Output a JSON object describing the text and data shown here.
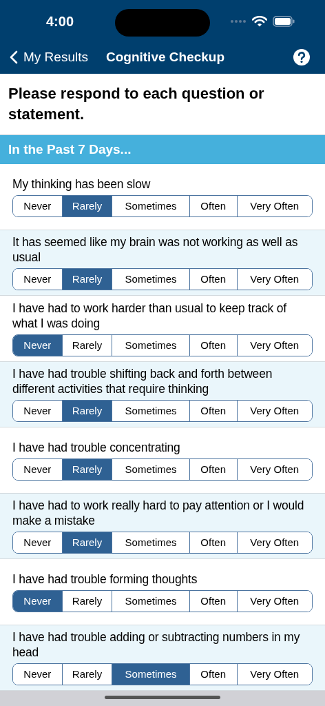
{
  "status_bar": {
    "time": "4:00"
  },
  "nav": {
    "back_label": "My Results",
    "title": "Cognitive Checkup"
  },
  "instructions": "Please respond to each question or statement.",
  "section_header": "In the Past 7 Days...",
  "questions": [
    {
      "text": "My thinking has been slow",
      "options": [
        {
          "label": "Never",
          "selected": false
        },
        {
          "label": "Rarely",
          "selected": true
        },
        {
          "label": "Sometimes",
          "selected": false
        },
        {
          "label": "Often",
          "selected": false
        },
        {
          "label": "Very Often",
          "selected": false
        }
      ]
    },
    {
      "text": "It has seemed like my brain was not working as well as usual",
      "options": [
        {
          "label": "Never",
          "selected": false
        },
        {
          "label": "Rarely",
          "selected": true
        },
        {
          "label": "Sometimes",
          "selected": false
        },
        {
          "label": "Often",
          "selected": false
        },
        {
          "label": "Very Often",
          "selected": false
        }
      ]
    },
    {
      "text": "I have had to work harder than usual to keep track of what I was doing",
      "options": [
        {
          "label": "Never",
          "selected": true
        },
        {
          "label": "Rarely",
          "selected": false
        },
        {
          "label": "Sometimes",
          "selected": false
        },
        {
          "label": "Often",
          "selected": false
        },
        {
          "label": "Very Often",
          "selected": false
        }
      ]
    },
    {
      "text": "I have had trouble shifting back and forth between different activities that require thinking",
      "options": [
        {
          "label": "Never",
          "selected": false
        },
        {
          "label": "Rarely",
          "selected": true
        },
        {
          "label": "Sometimes",
          "selected": false
        },
        {
          "label": "Often",
          "selected": false
        },
        {
          "label": "Very Often",
          "selected": false
        }
      ]
    },
    {
      "text": "I have had trouble concentrating",
      "options": [
        {
          "label": "Never",
          "selected": false
        },
        {
          "label": "Rarely",
          "selected": true
        },
        {
          "label": "Sometimes",
          "selected": false
        },
        {
          "label": "Often",
          "selected": false
        },
        {
          "label": "Very Often",
          "selected": false
        }
      ]
    },
    {
      "text": "I have had to work really hard to pay attention or I would make a mistake",
      "options": [
        {
          "label": "Never",
          "selected": false
        },
        {
          "label": "Rarely",
          "selected": true
        },
        {
          "label": "Sometimes",
          "selected": false
        },
        {
          "label": "Often",
          "selected": false
        },
        {
          "label": "Very Often",
          "selected": false
        }
      ]
    },
    {
      "text": "I have had trouble forming thoughts",
      "options": [
        {
          "label": "Never",
          "selected": true
        },
        {
          "label": "Rarely",
          "selected": false
        },
        {
          "label": "Sometimes",
          "selected": false
        },
        {
          "label": "Often",
          "selected": false
        },
        {
          "label": "Very Often",
          "selected": false
        }
      ]
    },
    {
      "text": "I have had trouble adding or subtracting numbers in my head",
      "options": [
        {
          "label": "Never",
          "selected": false
        },
        {
          "label": "Rarely",
          "selected": false
        },
        {
          "label": "Sometimes",
          "selected": true
        },
        {
          "label": "Often",
          "selected": false
        },
        {
          "label": "Very Often",
          "selected": false
        }
      ]
    }
  ]
}
